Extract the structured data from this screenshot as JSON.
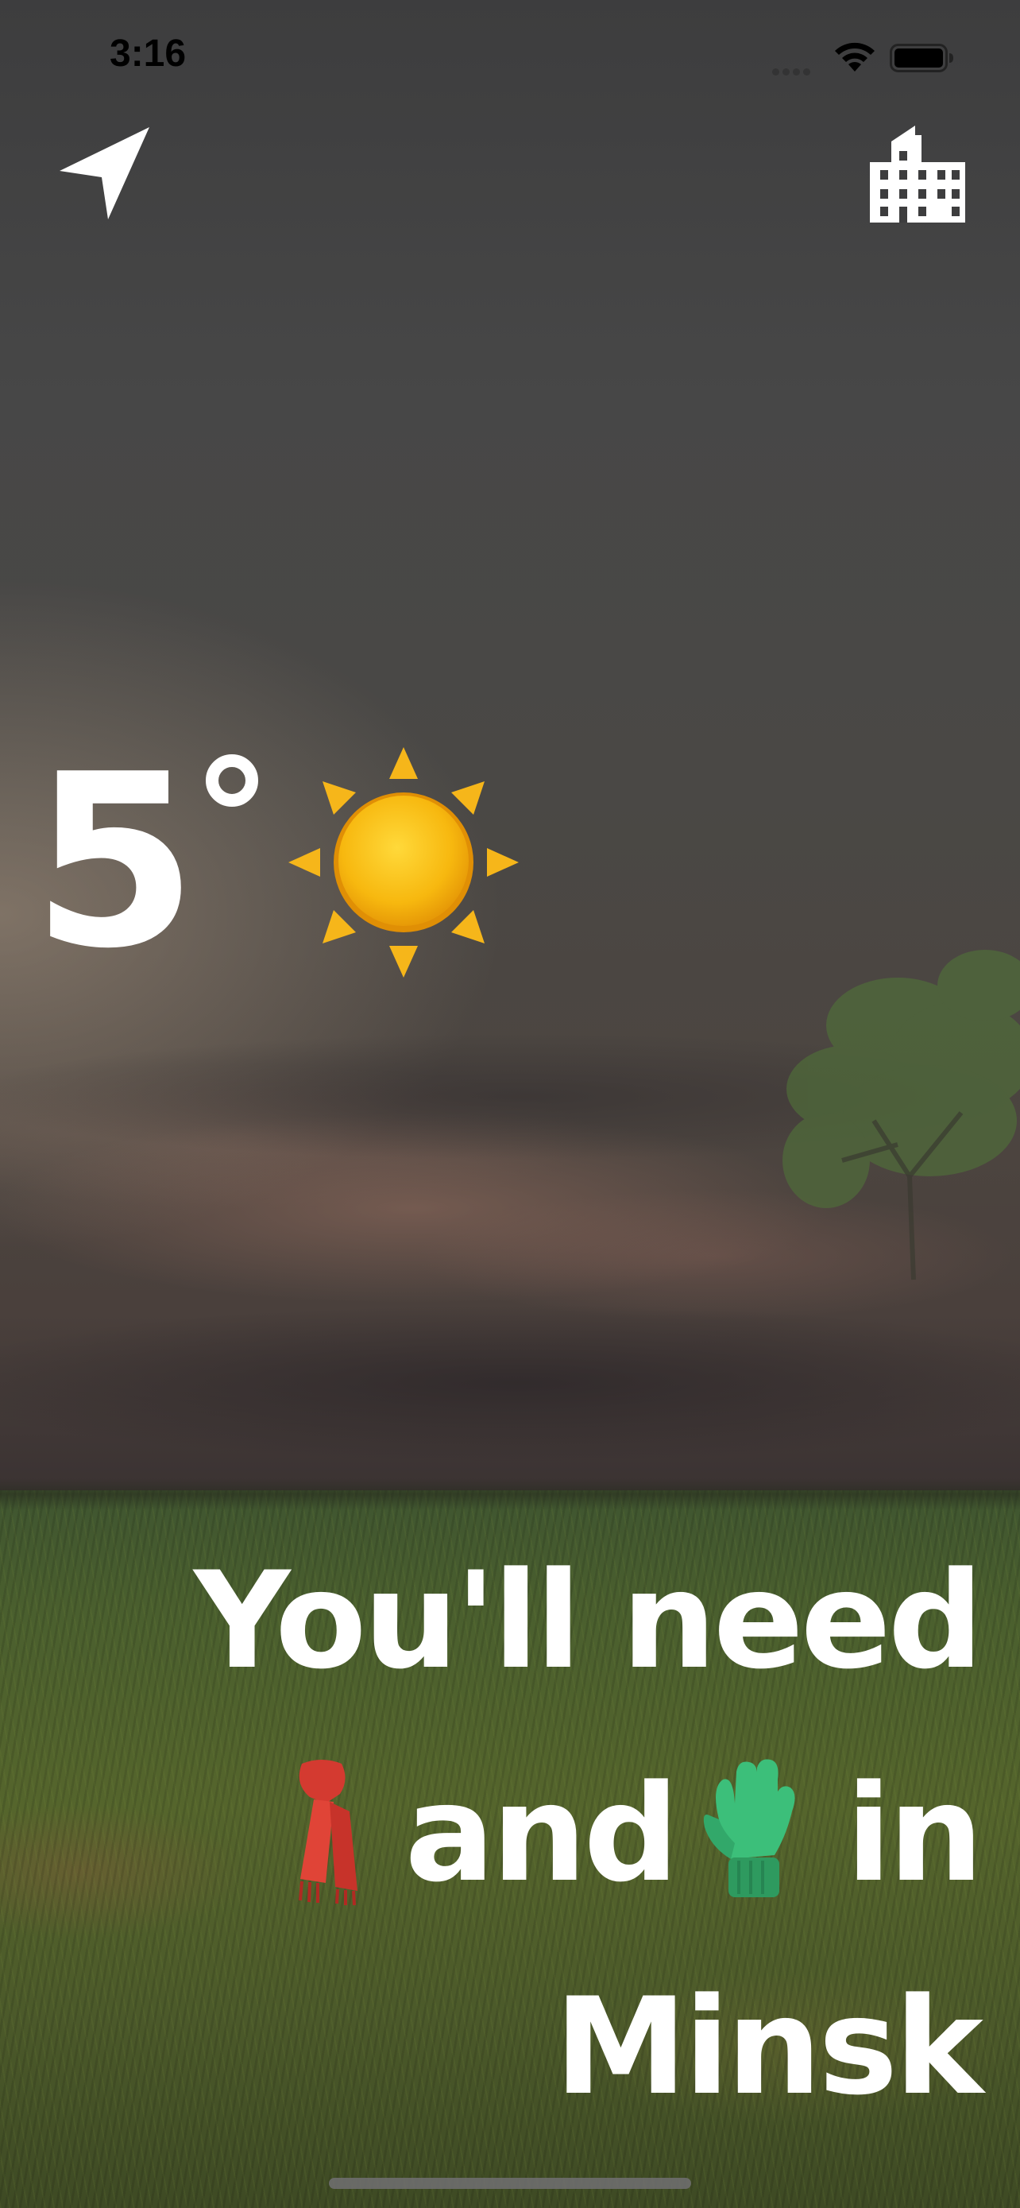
{
  "status_bar": {
    "time": "3:16",
    "wifi_icon": "wifi-icon",
    "battery_icon": "battery-icon"
  },
  "nav": {
    "location_icon": "location-arrow-icon",
    "city_icon": "building-icon"
  },
  "weather": {
    "temperature": "5",
    "unit_symbol": "°",
    "condition_icon": "sun-icon"
  },
  "message": {
    "line1": "You'll need",
    "line2_word": "and",
    "line2_end": "in",
    "city": "Minsk",
    "items": [
      "scarf-icon",
      "glove-icon"
    ]
  },
  "colors": {
    "text": "#ffffff",
    "sun_core": "#f5b50a",
    "scarf": "#d93a2f",
    "glove": "#3cbf7a"
  }
}
